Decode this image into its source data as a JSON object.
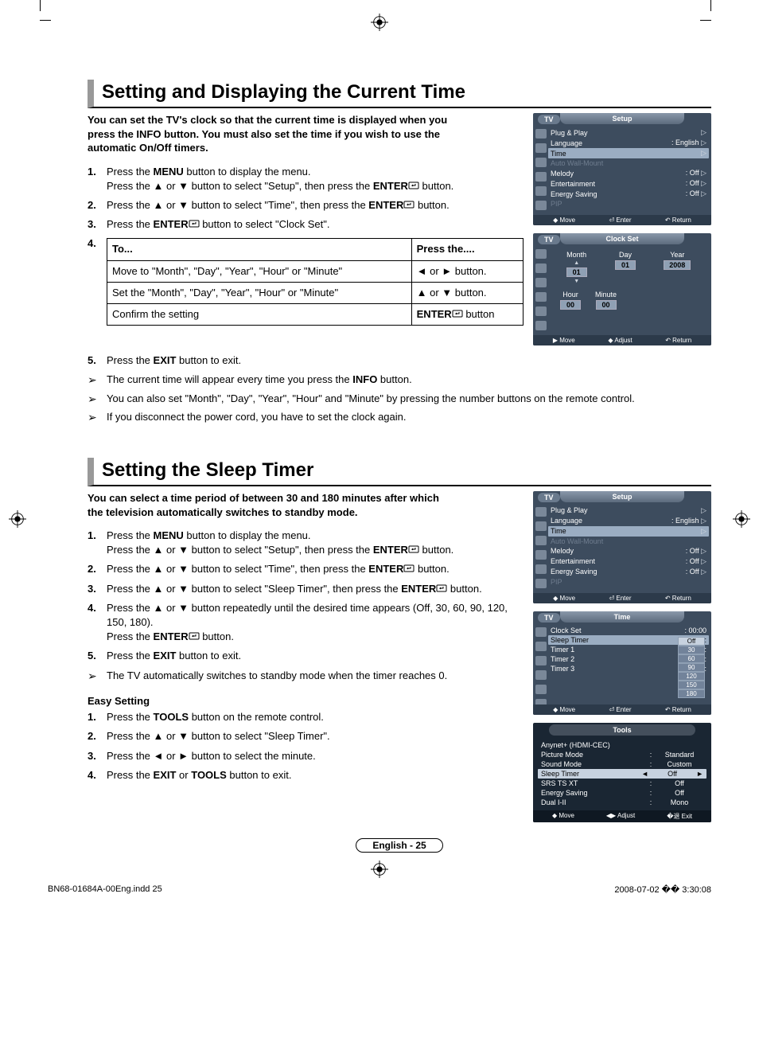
{
  "section1": {
    "title": "Setting and Displaying the Current Time",
    "intro": "You can set the TV's clock so that the current time is displayed when you press the INFO button. You must also set the time if you wish to use the automatic On/Off timers.",
    "steps": [
      {
        "num": "1.",
        "text": "Press the {b}MENU{/b} button to display the menu.\nPress the ▲ or ▼ button to select \"Setup\", then press the {b}ENTER{/b}{icon} button."
      },
      {
        "num": "2.",
        "text": "Press the ▲ or ▼ button to select \"Time\", then press the {b}ENTER{/b}{icon} button."
      },
      {
        "num": "3.",
        "text": "Press the {b}ENTER{/b}{icon} button to select \"Clock Set\"."
      },
      {
        "num": "4.",
        "text": ""
      }
    ],
    "table": {
      "head": [
        "To...",
        "Press the...."
      ],
      "rows": [
        [
          "Move to \"Month\", \"Day\", \"Year\", \"Hour\" or \"Minute\"",
          "◄ or ► button."
        ],
        [
          "Set the \"Month\", \"Day\", \"Year\", \"Hour\" or \"Minute\"",
          "▲ or ▼ button."
        ],
        [
          "Confirm the setting",
          "{b}ENTER{/b}{icon} button"
        ]
      ]
    },
    "step5": {
      "num": "5.",
      "text": "Press the {b}EXIT{/b} button to exit."
    },
    "notes": [
      "The current time will appear every time you press the {b}INFO{/b} button.",
      "You can also set \"Month\", \"Day\", \"Year\", \"Hour\" and \"Minute\" by pressing the number buttons on the remote control.",
      "If you disconnect the power cord, you have to set the clock again."
    ]
  },
  "section2": {
    "title": "Setting the Sleep Timer",
    "intro": "You can select a time period of between 30 and 180 minutes after which the television automatically switches to standby mode.",
    "steps": [
      {
        "num": "1.",
        "text": "Press the {b}MENU{/b} button to display the menu.\nPress the ▲ or ▼ button to select \"Setup\", then press the {b}ENTER{/b}{icon} button."
      },
      {
        "num": "2.",
        "text": "Press the ▲ or ▼ button to select \"Time\", then press the {b}ENTER{/b}{icon} button."
      },
      {
        "num": "3.",
        "text": "Press the ▲ or ▼ button to select \"Sleep Timer\", then press the {b}ENTER{/b}{icon} button."
      },
      {
        "num": "4.",
        "text": "Press the ▲ or ▼ button repeatedly until the desired time appears (Off, 30, 60, 90, 120, 150, 180).\nPress the {b}ENTER{/b}{icon} button."
      },
      {
        "num": "5.",
        "text": "Press the {b}EXIT{/b} button to exit."
      }
    ],
    "note": "The TV automatically switches to standby mode when the timer reaches 0.",
    "easy_heading": "Easy Setting",
    "easy_steps": [
      {
        "num": "1.",
        "text": "Press the {b}TOOLS{/b} button on the remote control."
      },
      {
        "num": "2.",
        "text": "Press the ▲ or ▼ button to select \"Sleep Timer\"."
      },
      {
        "num": "3.",
        "text": "Press the ◄ or ► button to select the minute."
      },
      {
        "num": "4.",
        "text": "Press the {b}EXIT{/b} or {b}TOOLS{/b} button to exit."
      }
    ]
  },
  "osd_setup": {
    "tv": "TV",
    "title": "Setup",
    "items": [
      {
        "lbl": "Plug & Play",
        "val": "",
        "tri": "▷"
      },
      {
        "lbl": "Language",
        "val": ": English",
        "tri": "▷"
      },
      {
        "lbl": "Time",
        "val": "",
        "tri": "▷",
        "sel": true
      },
      {
        "lbl": "Auto Wall-Mount",
        "val": "",
        "tri": "",
        "dim": true
      },
      {
        "lbl": "Melody",
        "val": ": Off",
        "tri": "▷"
      },
      {
        "lbl": "Entertainment",
        "val": ": Off",
        "tri": "▷"
      },
      {
        "lbl": "Energy Saving",
        "val": ": Off",
        "tri": "▷"
      },
      {
        "lbl": "PIP",
        "val": "",
        "tri": "",
        "dim": true
      }
    ],
    "foot": [
      "◆ Move",
      "⏎ Enter",
      "↶ Return"
    ]
  },
  "osd_clock": {
    "tv": "TV",
    "title": "Clock Set",
    "cols": [
      {
        "lbl": "Month",
        "val": "01",
        "arrows": true
      },
      {
        "lbl": "Day",
        "val": "01"
      },
      {
        "lbl": "Year",
        "val": "2008"
      }
    ],
    "cols2": [
      {
        "lbl": "Hour",
        "val": "00"
      },
      {
        "lbl": "Minute",
        "val": "00"
      }
    ],
    "foot": [
      "▶ Move",
      "◆ Adjust",
      "↶ Return"
    ]
  },
  "osd_time": {
    "tv": "TV",
    "title": "Time",
    "items": [
      {
        "lbl": "Clock Set",
        "val": ": 00:00"
      },
      {
        "lbl": "Sleep Timer",
        "val": ":",
        "sel": true
      },
      {
        "lbl": "Timer 1",
        "val": ":"
      },
      {
        "lbl": "Timer 2",
        "val": ":"
      },
      {
        "lbl": "Timer 3",
        "val": ":"
      }
    ],
    "dropdown": [
      "Off",
      "30",
      "60",
      "90",
      "120",
      "150",
      "180"
    ],
    "foot": [
      "◆ Move",
      "⏎ Enter",
      "↶ Return"
    ]
  },
  "osd_tools": {
    "title": "Tools",
    "items": [
      {
        "lbl": "Anynet+ (HDMI-CEC)",
        "val": ""
      },
      {
        "lbl": "Picture Mode",
        "val": "Standard"
      },
      {
        "lbl": "Sound Mode",
        "val": "Custom"
      },
      {
        "lbl": "Sleep Timer",
        "val": "Off",
        "sel": true
      },
      {
        "lbl": "SRS TS XT",
        "val": "Off"
      },
      {
        "lbl": "Energy Saving",
        "val": "Off"
      },
      {
        "lbl": "Dual I-II",
        "val": "Mono"
      }
    ],
    "foot": [
      "◆ Move",
      "◀▶ Adjust",
      "�退 Exit"
    ]
  },
  "page_badge": "English - 25",
  "footer": {
    "left": "BN68-01684A-00Eng.indd   25",
    "right": "2008-07-02   �� 3:30:08"
  }
}
